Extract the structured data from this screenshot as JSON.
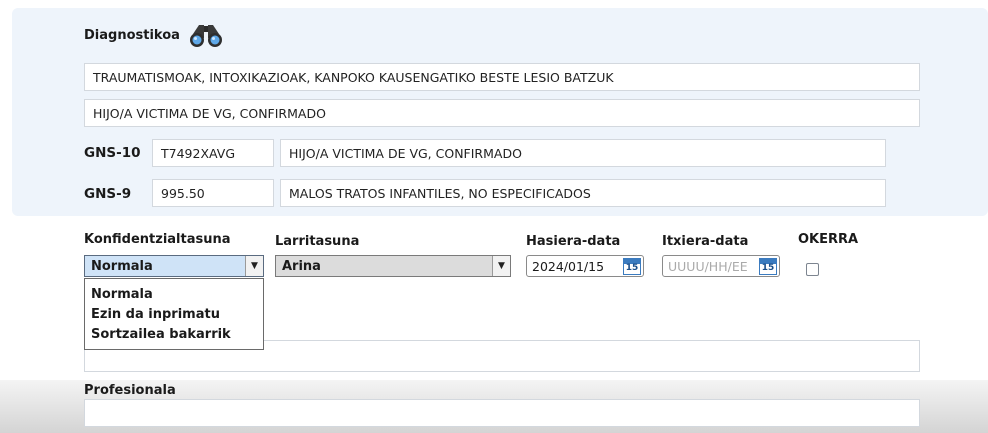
{
  "diagnosis": {
    "title": "Diagnostikoa",
    "icon": "binoculars-icon",
    "line1": "TRAUMATISMOAK, INTOXIKAZIOAK, KANPOKO KAUSENGATIKO BESTE LESIO BATZUK",
    "line2": "HIJO/A VICTIMA DE VG, CONFIRMADO",
    "gns10": {
      "label": "GNS-10",
      "code": "T7492XAVG",
      "description": "HIJO/A VICTIMA DE VG, CONFIRMADO"
    },
    "gns9": {
      "label": "GNS-9",
      "code": "995.50",
      "description": "MALOS TRATOS INFANTILES, NO ESPECIFICADOS"
    }
  },
  "form": {
    "confidentiality": {
      "label": "Konfidentzialtasuna",
      "value": "Normala",
      "options": [
        "Normala",
        "Ezin da inprimatu",
        "Sortzailea bakarrik"
      ]
    },
    "severity": {
      "label": "Larritasuna",
      "value": "Arina"
    },
    "start_date": {
      "label": "Hasiera-data",
      "value": "2024/01/15",
      "calendar_day": "15"
    },
    "end_date": {
      "label": "Itxiera-data",
      "placeholder": "UUUU/HH/EE",
      "calendar_day": "15"
    },
    "error": {
      "label": "OKERRA",
      "checked": false
    }
  },
  "professional": {
    "label": "Profesionala"
  }
}
